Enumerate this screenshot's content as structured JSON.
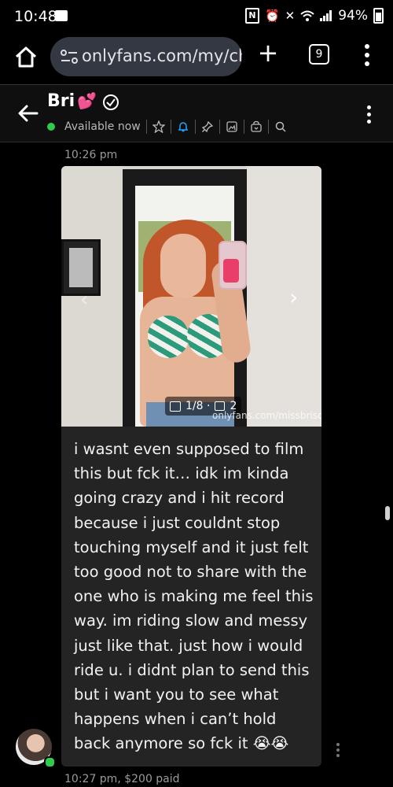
{
  "status_bar": {
    "time": "10:48",
    "battery": "94%",
    "nfc_label": "N"
  },
  "browser": {
    "url": "onlyfans.com/my/cha",
    "tab_count": "9"
  },
  "chat_header": {
    "name": "Bri",
    "heart_emoji": "💕",
    "availability": "Available now",
    "online_color": "#2fcb4f"
  },
  "message": {
    "time": "10:26 pm",
    "media": {
      "counter": "1/8 · ",
      "video_count": "2",
      "watermark": "onlyfans.com/missbrisolo"
    },
    "text": "i wasnt even supposed to film this but fck it… idk im kinda going crazy and i hit record because i just couldnt stop touching myself and it just felt too good not to share with the one who is making me feel this way. im riding slow and messy just like that. just how i would ride u. i didnt plan to send this but i want you to see what happens when i can’t hold back anymore so fck it 😭😭",
    "meta": "10:27 pm,  $200 paid"
  },
  "colors": {
    "background": "#000000",
    "bubble": "#242424",
    "url_box": "#343843",
    "accent_blue": "#1fa6ff"
  }
}
